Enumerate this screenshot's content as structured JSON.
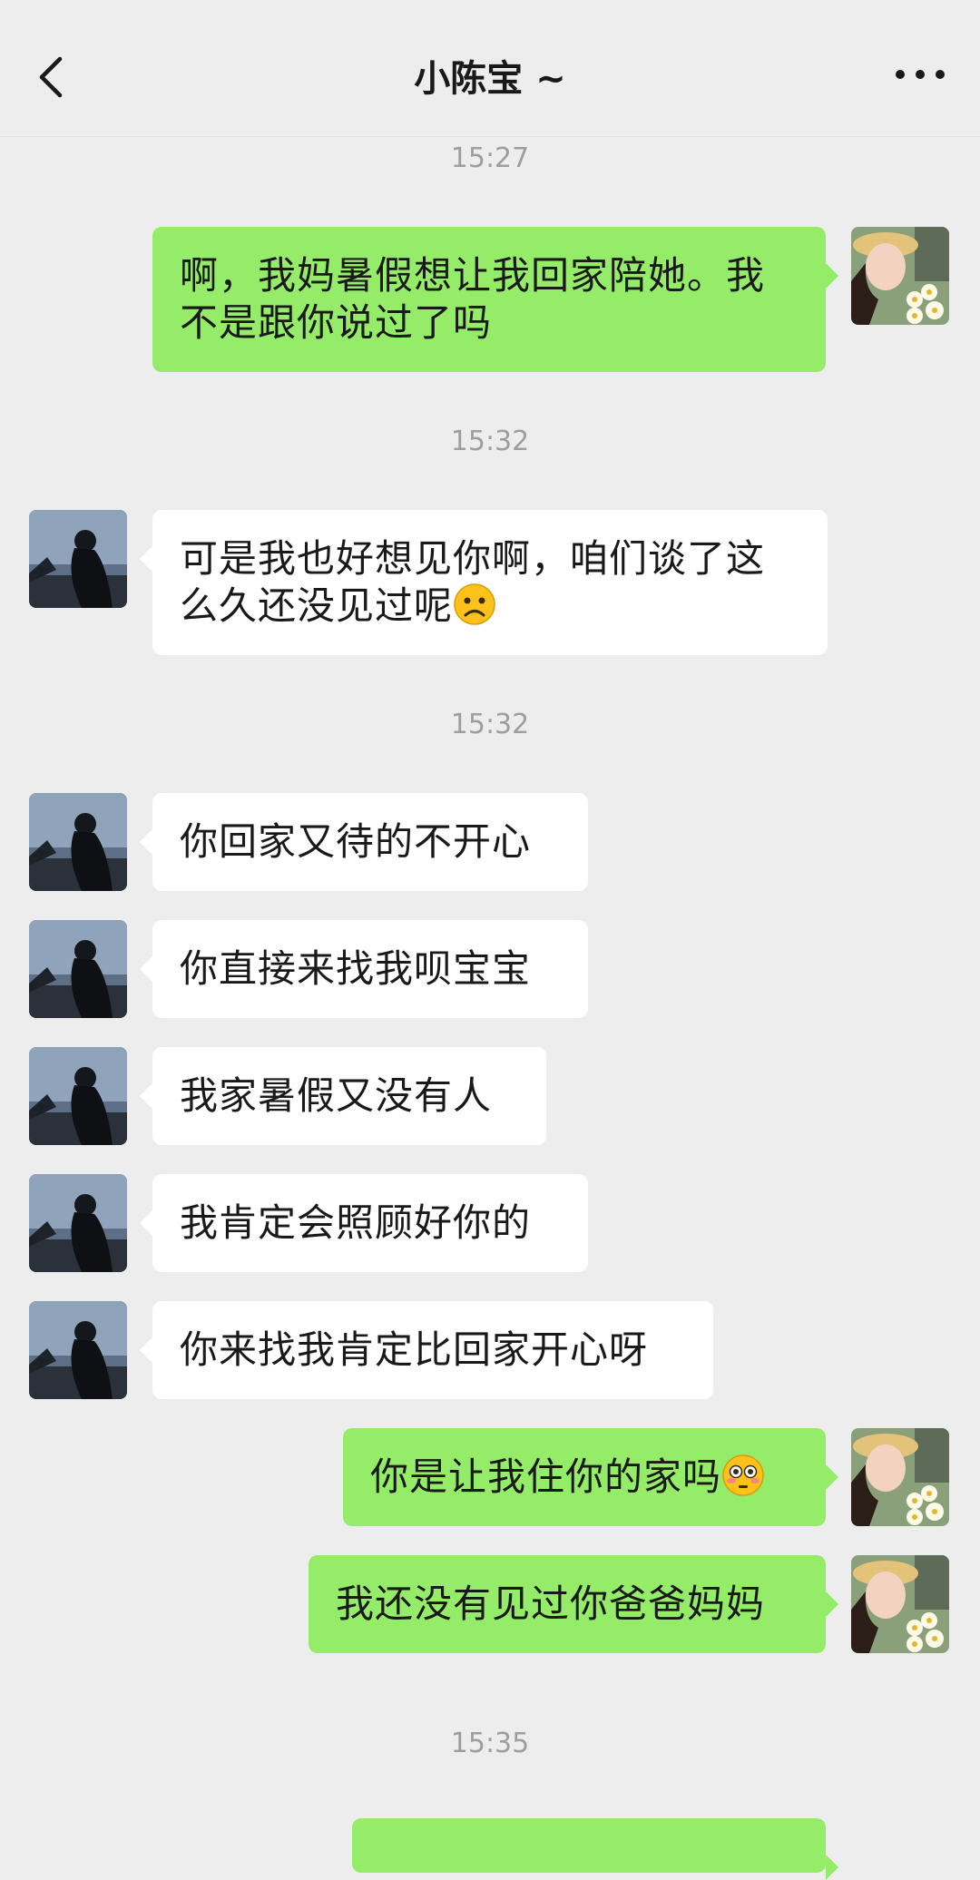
{
  "header": {
    "title": "小陈宝 ~",
    "back_icon": "chevron-left-icon",
    "more_icon": "ellipsis-icon"
  },
  "timestamps": [
    "15:27",
    "15:32",
    "15:32",
    "15:35"
  ],
  "messages": [
    {
      "side": "out",
      "text": "啊，我妈暑假想让我回家陪她。我不是跟你说过了吗"
    },
    {
      "side": "in",
      "text": "可是我也好想见你啊，咱们谈了这么久还没见过呢",
      "emoji": "frowning-face-emoji"
    },
    {
      "side": "in",
      "text": "你回家又待的不开心"
    },
    {
      "side": "in",
      "text": "你直接来找我呗宝宝"
    },
    {
      "side": "in",
      "text": "我家暑假又没有人"
    },
    {
      "side": "in",
      "text": "我肯定会照顾好你的"
    },
    {
      "side": "in",
      "text": "你来找我肯定比回家开心呀"
    },
    {
      "side": "out",
      "text": "你是让我住你的家吗",
      "emoji": "flushed-face-emoji"
    },
    {
      "side": "out",
      "text": "我还没有见过你爸爸妈妈"
    }
  ],
  "colors": {
    "background": "#ededed",
    "outgoing_bubble": "#95ec69",
    "incoming_bubble": "#ffffff",
    "timestamp_text": "#9e9e9e"
  }
}
